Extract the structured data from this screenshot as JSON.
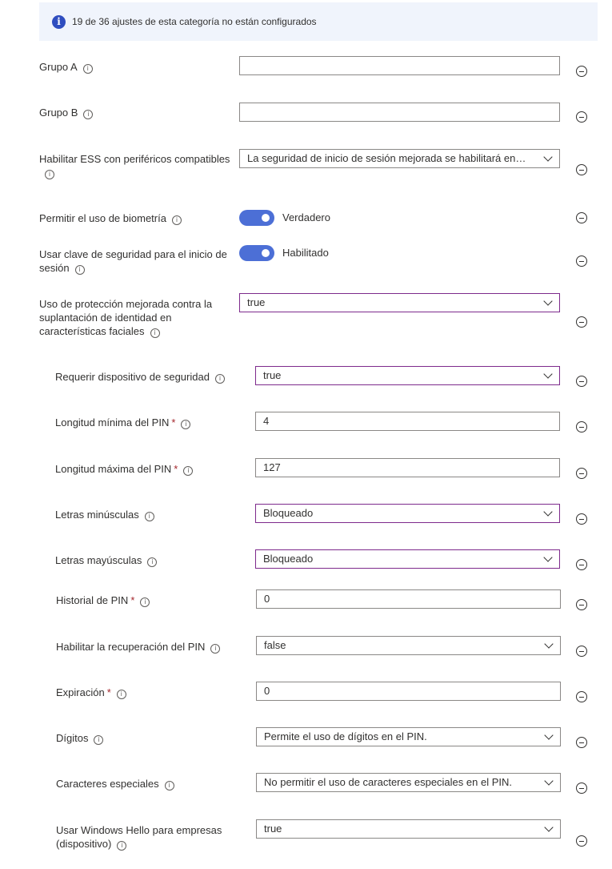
{
  "banner": {
    "text": "19 de 36 ajustes de esta categoría no están configurados",
    "icon": "info-icon"
  },
  "settings": [
    {
      "label": "Grupo A",
      "required": false,
      "type": "text",
      "value": ""
    },
    {
      "label": "Grupo B",
      "required": false,
      "type": "text",
      "value": ""
    },
    {
      "label": "Habilitar ESS con periféricos compatibles",
      "required": false,
      "type": "select",
      "value": "La seguridad de inicio de sesión mejorada se habilitará en sistemas con funciones compatibles"
    },
    {
      "label": "Permitir el uso de biometría",
      "required": false,
      "type": "toggle",
      "value": "Verdadero",
      "on": true
    },
    {
      "label": "Usar clave de seguridad para el inicio de sesión",
      "required": false,
      "type": "toggle",
      "value": "Habilitado",
      "on": true
    },
    {
      "label": "Uso de protección mejorada contra la suplantación de identidad en características faciales",
      "required": false,
      "type": "select",
      "value": "true"
    },
    {
      "label": "Requerir dispositivo de seguridad",
      "required": false,
      "type": "select",
      "value": "true"
    },
    {
      "label": "Longitud mínima del PIN",
      "required": true,
      "type": "text",
      "value": "4"
    },
    {
      "label": "Longitud máxima del PIN",
      "required": true,
      "type": "text",
      "value": "127"
    },
    {
      "label": "Letras minúsculas",
      "required": false,
      "type": "select",
      "value": "Bloqueado"
    },
    {
      "label": "Letras mayúsculas",
      "required": false,
      "type": "select",
      "value": "Bloqueado"
    },
    {
      "label": "Historial de PIN",
      "required": true,
      "type": "text",
      "value": "0"
    },
    {
      "label": "Habilitar la recuperación del PIN",
      "required": false,
      "type": "select",
      "value": "false"
    },
    {
      "label": "Expiración",
      "required": true,
      "type": "text",
      "value": "0"
    },
    {
      "label": "Dígitos",
      "required": false,
      "type": "select",
      "value": "Permite el uso de dígitos en el PIN."
    },
    {
      "label": "Caracteres especiales",
      "required": false,
      "type": "select",
      "value": "No permitir el uso de caracteres especiales en el PIN."
    },
    {
      "label": "Usar Windows Hello para empresas (dispositivo)",
      "required": false,
      "type": "select",
      "value": "true"
    }
  ],
  "colors": {
    "accent": "#4c6fd6",
    "focus_border": "#7d2a8c",
    "required": "#a4262c",
    "banner_bg": "#f0f4fc"
  }
}
